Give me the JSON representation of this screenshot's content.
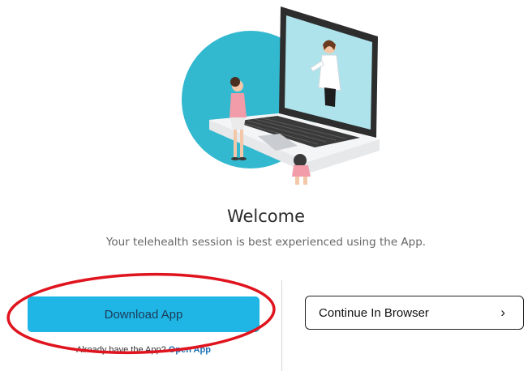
{
  "hero": {
    "illustration": "telehealth-laptop-illustration"
  },
  "welcome": {
    "title": "Welcome",
    "subtitle": "Your telehealth session is best experienced using the App."
  },
  "download": {
    "button_label": "Download App",
    "already_text": "Already have the App?",
    "open_app_label": "Open App"
  },
  "browser": {
    "button_label": "Continue In Browser",
    "chevron": "›"
  },
  "annotation": {
    "shape": "ellipse",
    "color": "#e0141e"
  },
  "colors": {
    "accent": "#1fb6e6",
    "hero_circle": "#33b9cf",
    "link": "#1a6fb3"
  }
}
